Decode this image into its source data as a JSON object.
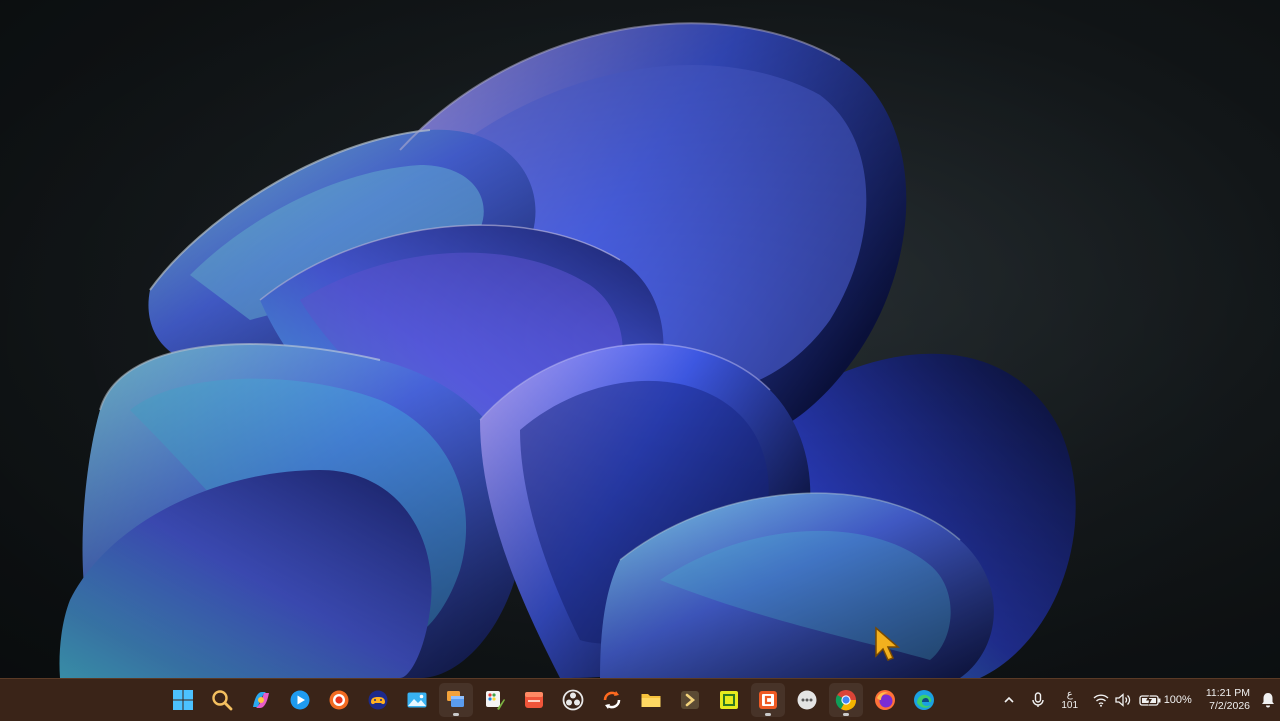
{
  "desktop": {
    "wallpaper": "windows-11-bloom-wallpaper",
    "colors": {
      "background": "#151a1d",
      "bloom_light": "#6ed8ff",
      "bloom_mid": "#4a66f0",
      "bloom_dark": "#0c1240",
      "taskbar": "#3a2418"
    }
  },
  "taskbar": {
    "apps": [
      {
        "name": "start-button",
        "icon": "windows-logo-icon",
        "active": false
      },
      {
        "name": "search-button",
        "icon": "search-icon",
        "active": false
      },
      {
        "name": "copilot-button",
        "icon": "copilot-icon",
        "active": false
      },
      {
        "name": "media-player-button",
        "icon": "play-icon",
        "active": false
      },
      {
        "name": "record-app-button",
        "icon": "record-icon",
        "active": false
      },
      {
        "name": "gamepad-app-button",
        "icon": "gamepad-icon",
        "active": false
      },
      {
        "name": "photos-button",
        "icon": "photos-icon",
        "active": false
      },
      {
        "name": "task-view-app-button",
        "icon": "windows-stack-icon",
        "active": true
      },
      {
        "name": "paint-button",
        "icon": "paint-icon",
        "active": false
      },
      {
        "name": "clipchamp-button",
        "icon": "video-editor-icon",
        "active": false
      },
      {
        "name": "obs-button",
        "icon": "obs-icon",
        "active": false
      },
      {
        "name": "sync-app-button",
        "icon": "sync-icon",
        "active": false
      },
      {
        "name": "file-explorer-button",
        "icon": "folder-icon",
        "active": false
      },
      {
        "name": "dev-app-button",
        "icon": "terminal-arrow-icon",
        "active": false
      },
      {
        "name": "notes-app-button",
        "icon": "note-icon",
        "active": false
      },
      {
        "name": "codec-app-button",
        "icon": "code-app-icon",
        "active": true
      },
      {
        "name": "chat-app-button",
        "icon": "chat-bubble-icon",
        "active": false
      },
      {
        "name": "chrome-button",
        "icon": "chrome-icon",
        "active": true
      },
      {
        "name": "firefox-button",
        "icon": "firefox-icon",
        "active": false
      },
      {
        "name": "edge-button",
        "icon": "edge-icon",
        "active": false
      }
    ],
    "tray": {
      "language_top": "ع",
      "language_bottom": "101",
      "battery_percent": "100%",
      "time": "11:21 PM",
      "date": "7/2/2026"
    }
  }
}
